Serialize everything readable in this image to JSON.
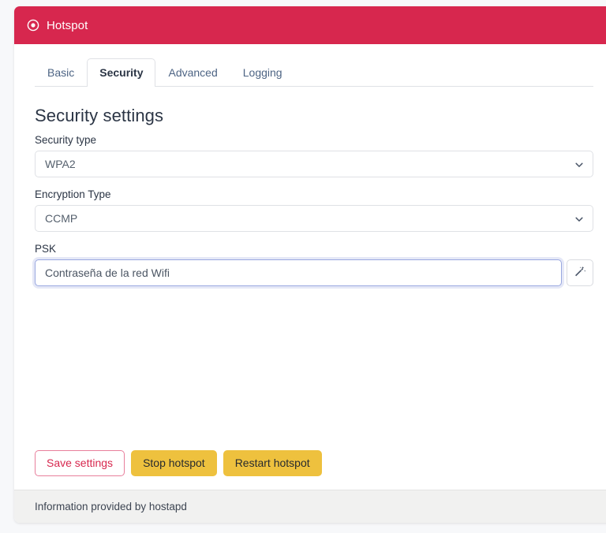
{
  "window": {
    "title": "Hotspot",
    "icon": "record-circle-icon",
    "header_color": "#d7274e"
  },
  "tabs": [
    {
      "label": "Basic",
      "active": false
    },
    {
      "label": "Security",
      "active": true
    },
    {
      "label": "Advanced",
      "active": false
    },
    {
      "label": "Logging",
      "active": false
    }
  ],
  "main": {
    "section_title": "Security settings",
    "fields": {
      "security_type": {
        "label": "Security type",
        "value": "WPA2",
        "options": [
          "WPA2"
        ],
        "icon": "chevron-down-icon"
      },
      "encryption_type": {
        "label": "Encryption Type",
        "value": "CCMP",
        "options": [
          "CCMP"
        ],
        "icon": "chevron-down-icon"
      },
      "psk": {
        "label": "PSK",
        "value": "Contraseña de la red Wifi",
        "placeholder": "",
        "focused": true,
        "generate_icon": "magic-wand-icon"
      }
    }
  },
  "actions": {
    "save": "Save settings",
    "stop": "Stop hotspot",
    "restart": "Restart hotspot"
  },
  "footer": {
    "text": "Information provided by hostapd"
  },
  "colors": {
    "accent_red": "#d7274e",
    "warning_yellow": "#eec13e",
    "focus_border": "#9aa8e0",
    "footer_bg": "#f1f1f0"
  }
}
